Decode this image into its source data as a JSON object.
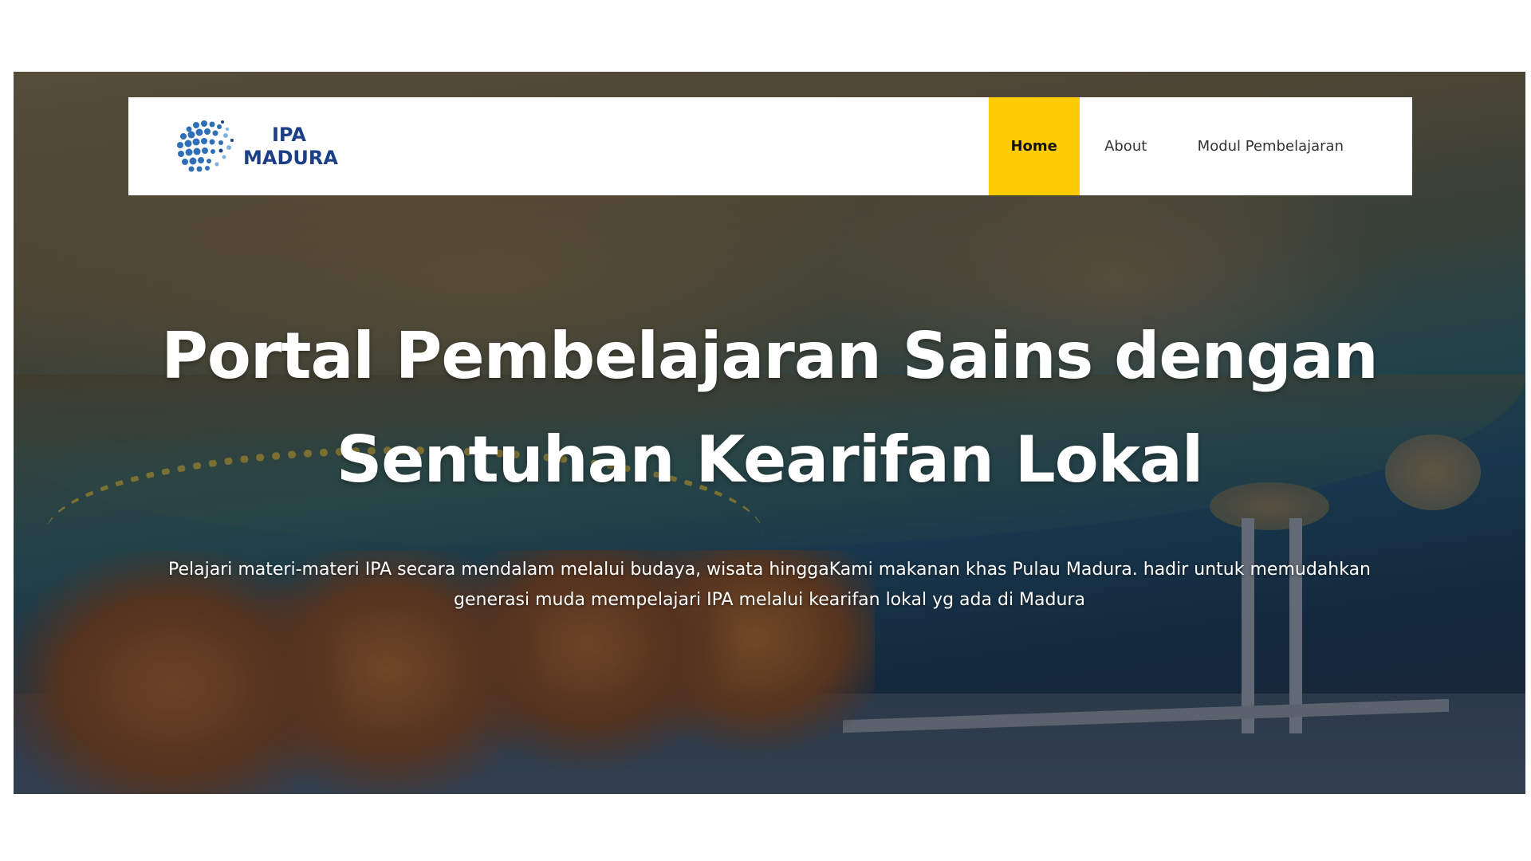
{
  "brand": {
    "line1": "IPA",
    "line2": "MADURA",
    "logo_icon": "dotted-globe-icon",
    "color": "#1c3f86"
  },
  "nav": {
    "items": [
      {
        "label": "Home",
        "active": true
      },
      {
        "label": "About",
        "active": false
      },
      {
        "label": "Modul Pembelajaran",
        "active": false
      }
    ],
    "active_color": "#ffcb05"
  },
  "hero": {
    "title_line1": "Portal Pembelajaran Sains dengan",
    "title_line2": "Sentuhan Kearifan Lokal",
    "description": "Pelajari materi-materi IPA secara mendalam melalui budaya, wisata hinggaKami makanan khas Pulau Madura.  hadir untuk memudahkan generasi muda mempelajari IPA melalui kearifan lokal yg ada di Madura"
  }
}
